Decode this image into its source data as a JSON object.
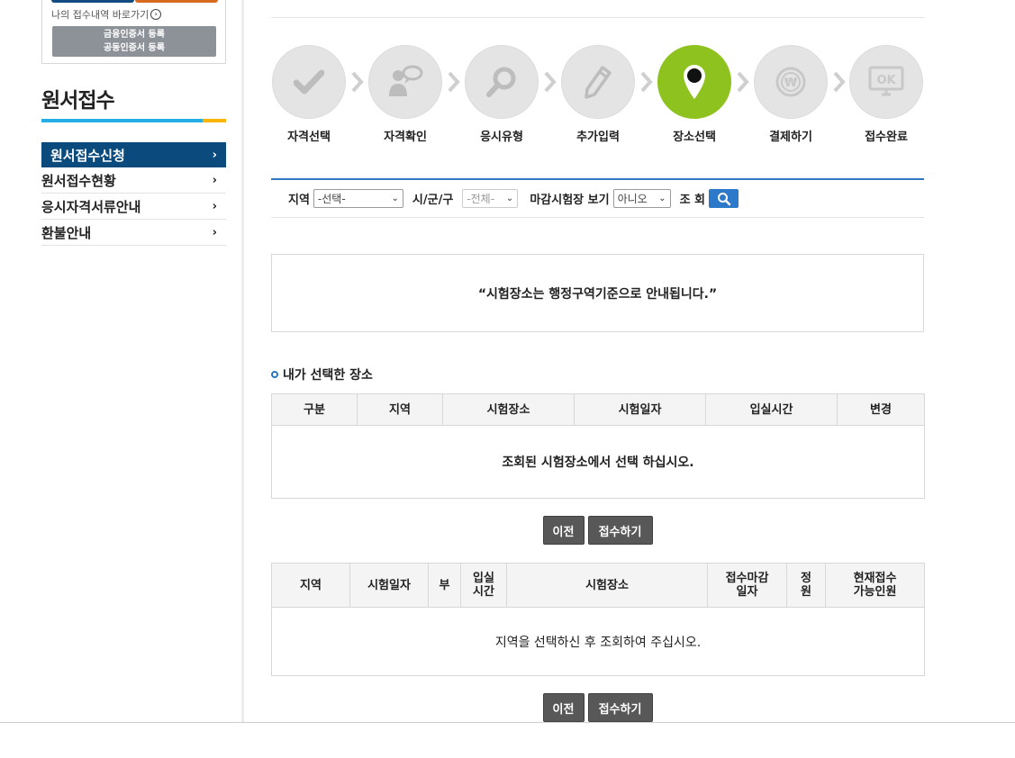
{
  "login": {
    "my_link": "나의 접수내역 바로가기",
    "cert_line1": "금융인증서 등록",
    "cert_line2": "공동인증서 등록"
  },
  "sidebar": {
    "title": "원서접수",
    "items": [
      {
        "label": "원서접수신청"
      },
      {
        "label": "원서접수현황"
      },
      {
        "label": "응시자격서류안내"
      },
      {
        "label": "환불안내"
      }
    ]
  },
  "steps": [
    {
      "label": "자격선택",
      "icon": "check-icon"
    },
    {
      "label": "자격확인",
      "icon": "person-speech-icon"
    },
    {
      "label": "응시유형",
      "icon": "magnifier-icon"
    },
    {
      "label": "추가입력",
      "icon": "pencil-icon"
    },
    {
      "label": "장소선택",
      "icon": "map-pin-icon"
    },
    {
      "label": "결제하기",
      "icon": "won-coin-icon"
    },
    {
      "label": "접수완료",
      "icon": "ok-monitor-icon"
    }
  ],
  "active_step": 4,
  "colors": {
    "active_step": "#8ec21f",
    "accent": "#2b79c8",
    "nav_active": "#0b4a7d"
  },
  "filter": {
    "region_label": "지역",
    "region_value": "-선택-",
    "city_label": "시/군/구",
    "city_value": "-전체-",
    "closed_label": "마감시험장 보기",
    "closed_value": "아니오",
    "search_label": "조 회"
  },
  "notice": "“시험장소는 행정구역기준으로 안내됩니다.”",
  "selected": {
    "title": "내가 선택한 장소",
    "headers": [
      "구분",
      "지역",
      "시험장소",
      "시험일자",
      "입실시간",
      "변경"
    ],
    "empty": "조회된 시험장소에서 선택 하십시오."
  },
  "buttons": {
    "prev": "이전",
    "next": "접수하기"
  },
  "list": {
    "headers": [
      "지역",
      "시험일자",
      "부",
      "입실\n시간",
      "시험장소",
      "접수마감\n일자",
      "정\n원",
      "현재접수\n가능인원"
    ],
    "empty": "지역을 선택하신 후 조회하여 주십시오."
  }
}
